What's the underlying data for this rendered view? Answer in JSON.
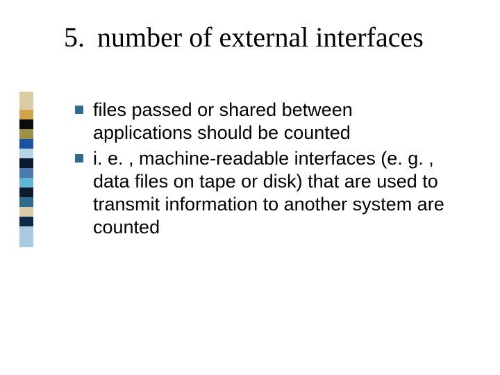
{
  "slide": {
    "number": "5.",
    "title": "number of external interfaces",
    "bullets": [
      "files passed or shared between applications should be counted",
      "i. e. , machine-readable interfaces (e. g. , data files on tape or disk) that are used to transmit information to another system are counted"
    ]
  },
  "decoration_colors": [
    "#d9cda5",
    "#cfa64a",
    "#0b0b0b",
    "#9c8f46",
    "#1b52a3",
    "#b7d4e6",
    "#0d1a2e",
    "#4c78b0",
    "#5fb7d3",
    "#0e1c30",
    "#2f6a8f",
    "#d9cda5",
    "#0f2a49",
    "#a9c9e0"
  ],
  "decoration_heights": [
    26,
    14,
    14,
    14,
    14,
    14,
    14,
    14,
    14,
    14,
    14,
    14,
    14,
    30
  ]
}
